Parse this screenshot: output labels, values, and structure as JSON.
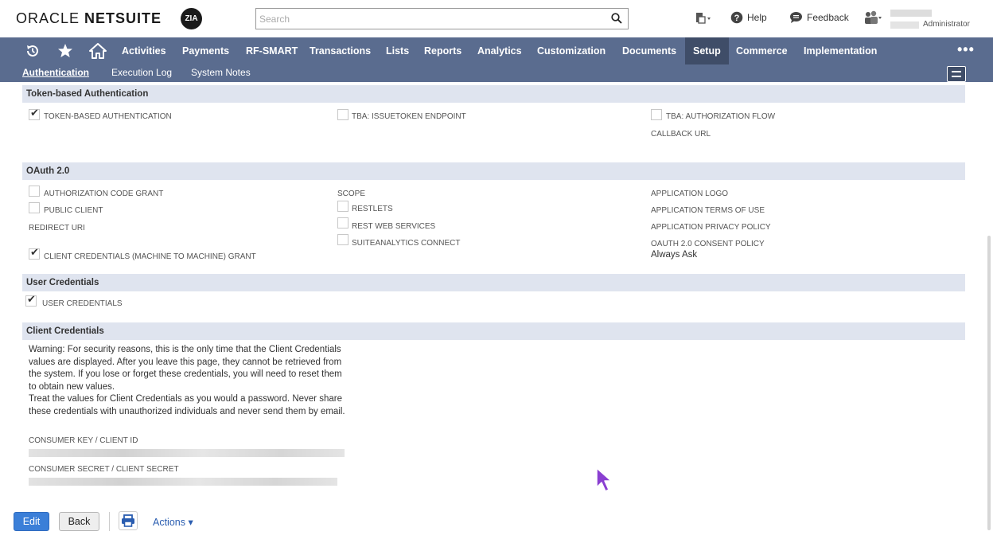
{
  "header": {
    "logo_text_1": "ORACLE",
    "logo_text_2": " NETSUITE",
    "zia_label": "ZIA",
    "search_placeholder": "Search",
    "help_label": "Help",
    "feedback_label": "Feedback",
    "role_label": "Administrator"
  },
  "nav": {
    "items": [
      "Activities",
      "Payments",
      "RF-SMART",
      "Transactions",
      "Lists",
      "Reports",
      "Analytics",
      "Customization",
      "Documents",
      "Setup",
      "Commerce",
      "Implementation"
    ],
    "active": "Setup",
    "more_label": "•••"
  },
  "subnav": {
    "tab1": "Authentication",
    "tab2": "Execution Log",
    "tab3": "System Notes"
  },
  "tba": {
    "title": "Token-based Authentication",
    "token_based_auth": "TOKEN-BASED AUTHENTICATION",
    "issuetoken": "TBA: ISSUETOKEN ENDPOINT",
    "auth_flow": "TBA: AUTHORIZATION FLOW",
    "callback": "CALLBACK URL"
  },
  "oauth": {
    "title": "OAuth 2.0",
    "auth_code_grant": "AUTHORIZATION CODE GRANT",
    "public_client": "PUBLIC CLIENT",
    "redirect_uri": "REDIRECT URI",
    "client_credentials_grant": "CLIENT CREDENTIALS (MACHINE TO MACHINE) GRANT",
    "scope": "SCOPE",
    "restlets": "RESTLETS",
    "rest_web_services": "REST WEB SERVICES",
    "suiteanalytics": "SUITEANALYTICS CONNECT",
    "app_logo": "APPLICATION LOGO",
    "app_terms": "APPLICATION TERMS OF USE",
    "app_privacy": "APPLICATION PRIVACY POLICY",
    "consent_policy": "OAUTH 2.0 CONSENT POLICY",
    "consent_value": "Always Ask"
  },
  "user_creds": {
    "title": "User Credentials",
    "label": "USER CREDENTIALS"
  },
  "client_creds": {
    "title": "Client Credentials",
    "warning_1": "Warning: For security reasons, this is the only time that the Client Credentials values are displayed. After you leave this page, they cannot be retrieved from the system. If you lose or forget these credentials, you will need to reset them to obtain new values.",
    "warning_2": "Treat the values for Client Credentials as you would a password. Never share these credentials with unauthorized individuals and never send them by email.",
    "consumer_key_label": "CONSUMER KEY / CLIENT ID",
    "consumer_secret_label": "CONSUMER SECRET / CLIENT SECRET"
  },
  "footer": {
    "edit": "Edit",
    "back": "Back",
    "actions": "Actions ▾"
  },
  "colors": {
    "nav_bg": "#5a6c8f",
    "nav_active": "#3f4d68",
    "section_bg": "#dfe4ef",
    "primary_button": "#3b7fd8"
  }
}
